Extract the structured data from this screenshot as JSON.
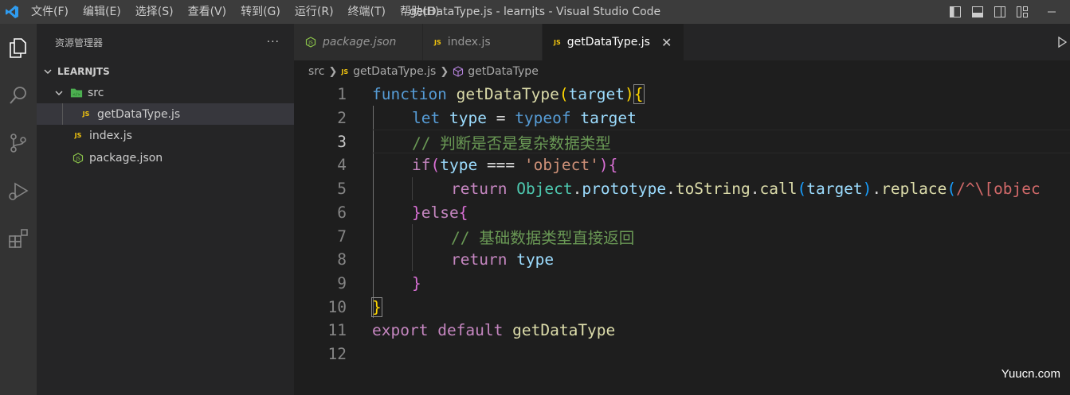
{
  "titlebar": {
    "menu": [
      "文件(F)",
      "编辑(E)",
      "选择(S)",
      "查看(V)",
      "转到(G)",
      "运行(R)",
      "终端(T)",
      "帮助(H)"
    ],
    "window_title": "getDataType.js - learnjts - Visual Studio Code"
  },
  "sidebar": {
    "title": "资源管理器",
    "more": "···",
    "project": "LEARNJTS",
    "folder": "src",
    "files": {
      "getdatatype": "getDataType.js",
      "index": "index.js",
      "package": "package.json"
    }
  },
  "tabs": [
    {
      "label": "package.json",
      "active": false
    },
    {
      "label": "index.js",
      "active": false
    },
    {
      "label": "getDataType.js",
      "active": true
    }
  ],
  "tab_close": "✕",
  "breadcrumb": {
    "folder": "src",
    "file": "getDataType.js",
    "symbol": "getDataType"
  },
  "editor": {
    "line_numbers": [
      "1",
      "2",
      "3",
      "4",
      "5",
      "6",
      "7",
      "8",
      "9",
      "10",
      "11",
      "12"
    ],
    "active_line": 3,
    "code": {
      "l1": {
        "kw": "function",
        "name": "getDataType",
        "open": "(",
        "param": "target",
        "close": ")",
        "brace": "{"
      },
      "l2": {
        "kw": "let",
        "var": "type",
        "eq": " = ",
        "op": "typeof",
        "arg": "target"
      },
      "l3": {
        "comment": "// 判断是否是复杂数据类型"
      },
      "l4": {
        "kw": "if",
        "open": "(",
        "var": "type",
        "eq": " === ",
        "str": "'object'",
        "close": ")",
        "brace": "{"
      },
      "l5": {
        "kw": "return",
        "obj": "Object",
        "dot1": ".",
        "proto": "prototype",
        "dot2": ".",
        "tostr": "toString",
        "dot3": ".",
        "call": "call",
        "open": "(",
        "arg": "target",
        "close": ")",
        "dot4": ".",
        "replace": "replace",
        "open2": "(",
        "regex": "/^\\[objec"
      },
      "l6": {
        "close": "}",
        "kw": "else",
        "brace": "{"
      },
      "l7": {
        "comment": "// 基础数据类型直接返回"
      },
      "l8": {
        "kw": "return",
        "var": "type"
      },
      "l9": {
        "brace": "}"
      },
      "l10": {
        "brace": "}"
      },
      "l11": {
        "kw1": "export",
        "kw2": "default",
        "name": "getDataType"
      }
    }
  },
  "watermark": "Yuucn.com",
  "colors": {
    "keyword": "#569cd6",
    "control": "#c586c0",
    "function": "#dcdcaa",
    "variable": "#9cdcfe",
    "string": "#ce9178",
    "comment": "#6a9955",
    "class": "#4ec9b0",
    "bracket_gold": "#ffd700",
    "bracket_orchid": "#da70d6",
    "bracket_blue": "#179fff"
  }
}
